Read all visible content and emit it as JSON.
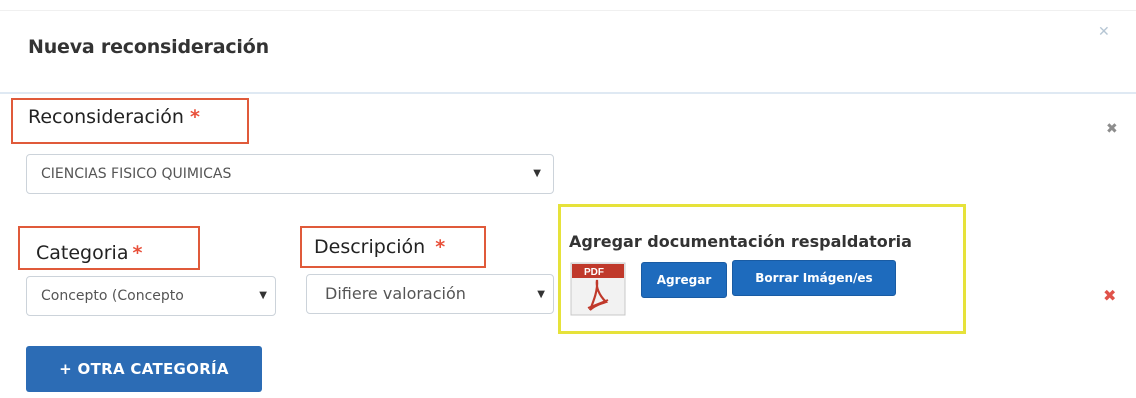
{
  "modal": {
    "title": "Nueva reconsideración",
    "close_glyph": "✕"
  },
  "form": {
    "reconsideracion": {
      "label": "Reconsideración",
      "required_mark": "*",
      "value": "CIENCIAS FISICO QUIMICAS"
    },
    "categoria": {
      "label": "Categoria",
      "required_mark": "*",
      "value": "Concepto (Concepto"
    },
    "descripcion": {
      "label": "Descripción",
      "required_mark": "*",
      "value": "Difiere valoración"
    },
    "documentacion": {
      "title": "Agregar documentación respaldatoria",
      "file_icon": "pdf-file-icon",
      "file_icon_text": "PDF",
      "add_label": "Agregar",
      "clear_label": "Borrar Imágen/es"
    },
    "otra_categoria_label": "+ OTRA CATEGORÍA",
    "select_arrow": "▼",
    "remove_glyph": "✖"
  },
  "colors": {
    "annotation_red": "#e05a3a",
    "annotation_yellow": "#e6e23a",
    "button_blue": "#1e6bbd",
    "required_red": "#e8503a"
  }
}
